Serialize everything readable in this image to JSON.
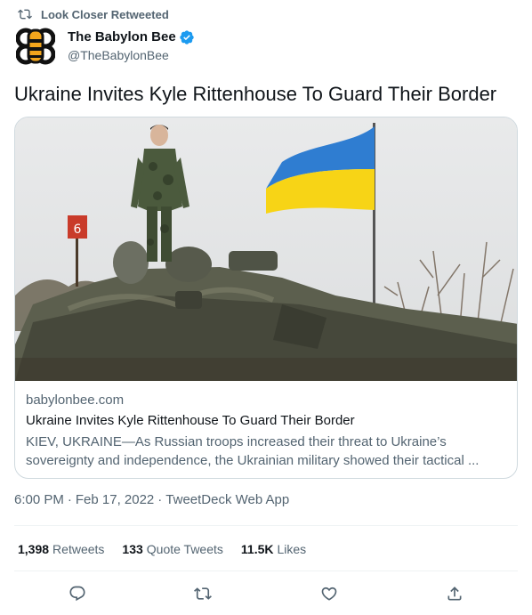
{
  "retweet_bar": {
    "label": "Look Closer Retweeted",
    "icon": "retweet-icon"
  },
  "author": {
    "display_name": "The Babylon Bee",
    "handle": "@TheBabylonBee",
    "verified": true,
    "avatar_icon": "bee-logo",
    "verified_color": "#1d9bf0"
  },
  "tweet": {
    "text": "Ukraine Invites Kyle Rittenhouse To Guard Their Border"
  },
  "card": {
    "image_icon": "soldier-on-tank-with-ukrainian-flag",
    "domain": "babylonbee.com",
    "title": "Ukraine Invites Kyle Rittenhouse To Guard Their Border",
    "description": "KIEV, UKRAINE—As Russian troops increased their threat to Ukraine’s sovereignty and independence, the Ukrainian military showed their tactical ..."
  },
  "meta": {
    "time": "6:00 PM",
    "separator": "·",
    "date": "Feb 17, 2022",
    "source": "TweetDeck Web App"
  },
  "stats": {
    "retweets_count": "1,398",
    "retweets_label": "Retweets",
    "quotes_count": "133",
    "quotes_label": "Quote Tweets",
    "likes_count": "11.5K",
    "likes_label": "Likes"
  },
  "actions": [
    "reply-icon",
    "retweet-icon",
    "like-icon",
    "share-icon"
  ],
  "colors": {
    "text_primary": "#0f1419",
    "text_secondary": "#536471",
    "border": "#cfd9de",
    "flag_blue": "#2f7dd1",
    "flag_yellow": "#f7d416"
  }
}
